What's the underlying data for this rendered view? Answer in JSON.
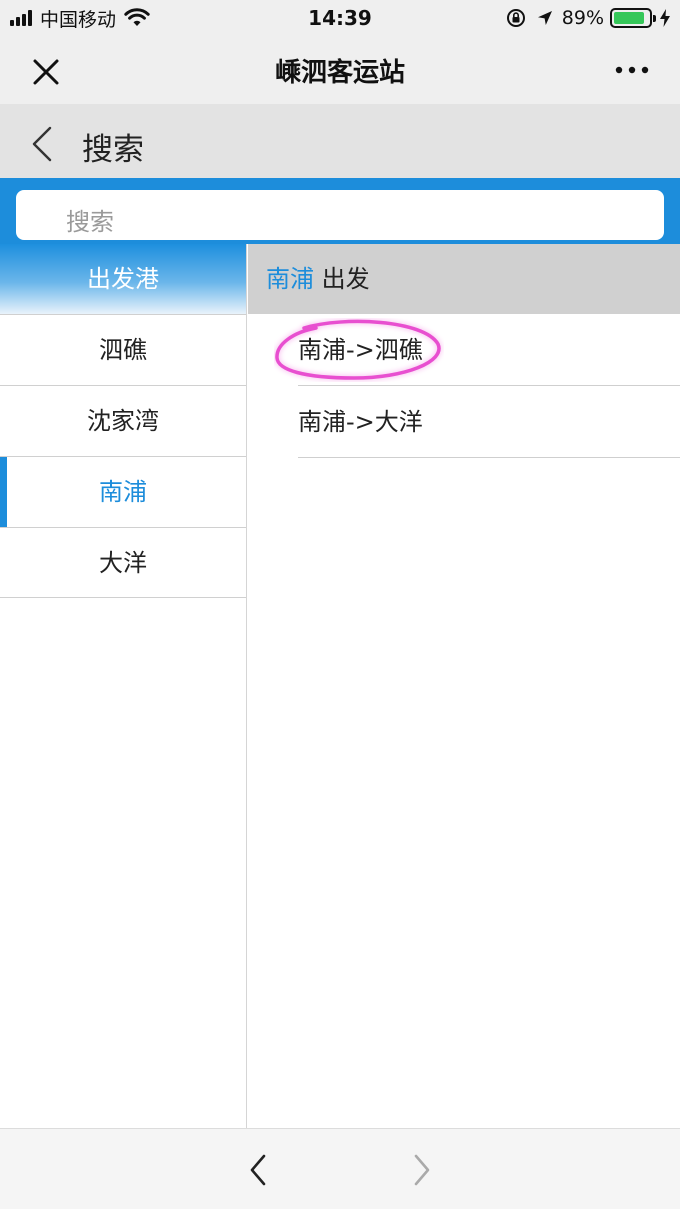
{
  "status_bar": {
    "carrier": "中国移动",
    "time": "14:39",
    "battery_percent": "89%",
    "battery_level": 0.89,
    "icons": [
      "signal-icon",
      "wifi-icon",
      "orientation-lock-icon",
      "location-icon",
      "battery-icon",
      "charging-icon"
    ]
  },
  "navbar": {
    "title": "嵊泗客运站",
    "close_icon": "close-icon",
    "more_icon": "more-icon"
  },
  "page": {
    "title": "搜索",
    "back_icon": "chevron-left-icon"
  },
  "search": {
    "placeholder": "搜索"
  },
  "departure": {
    "header": "出发港",
    "ports": [
      {
        "label": "泗礁",
        "active": false
      },
      {
        "label": "沈家湾",
        "active": false
      },
      {
        "label": "南浦",
        "active": true
      },
      {
        "label": "大洋",
        "active": false
      }
    ]
  },
  "routes": {
    "header_port": "南浦",
    "header_suffix": "出发",
    "items": [
      {
        "label": "南浦->泗礁"
      },
      {
        "label": "南浦->大洋"
      }
    ]
  },
  "toolbar": {
    "back_icon": "chevron-left-icon",
    "forward_icon": "chevron-right-icon"
  },
  "colors": {
    "accent": "#1d8ddb",
    "annotation": "#e84fd0",
    "header_gray": "#d0d0d0"
  }
}
